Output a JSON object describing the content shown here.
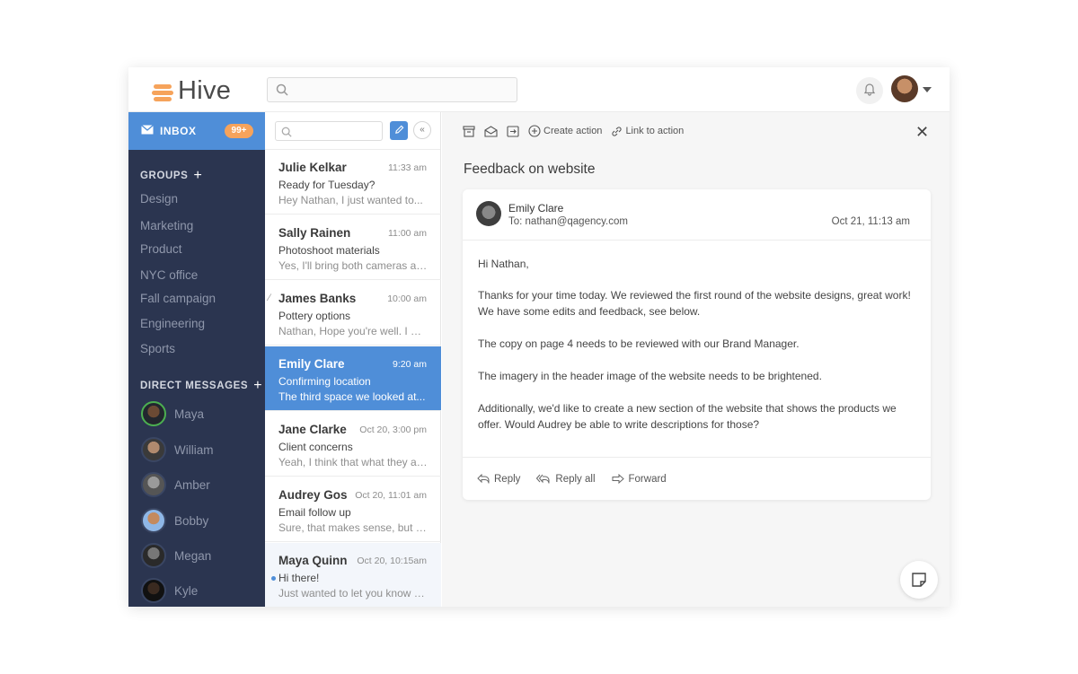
{
  "app": {
    "name": "Hive"
  },
  "header": {
    "search_placeholder": ""
  },
  "sidebar": {
    "inbox_label": "INBOX",
    "inbox_badge": "99+",
    "groups_label": "GROUPS",
    "groups": [
      "Design",
      "Marketing",
      "Product",
      "NYC office",
      "Fall campaign",
      "Engineering",
      "Sports"
    ],
    "dm_label": "DIRECT MESSAGES",
    "direct_messages": [
      "Maya",
      "William",
      "Amber",
      "Bobby",
      "Megan",
      "Kyle"
    ]
  },
  "messages": [
    {
      "sender": "Julie Kelkar",
      "time": "11:33 am",
      "subject": "Ready for Tuesday?",
      "preview": "Hey Nathan, I just wanted to..."
    },
    {
      "sender": "Sally Rainen",
      "time": "11:00 am",
      "subject": "Photoshoot materials",
      "preview": "Yes, I'll bring both cameras an..."
    },
    {
      "sender": "James Banks",
      "time": "10:00 am",
      "subject": "Pottery options",
      "preview": "Nathan, Hope you're well. I wi..."
    },
    {
      "sender": "Emily Clare",
      "time": "9:20 am",
      "subject": "Confirming location",
      "preview": "The third space we looked at..."
    },
    {
      "sender": "Jane Clarke",
      "time": "Oct 20, 3:00 pm",
      "subject": "Client concerns",
      "preview": "Yeah, I think that what they are..."
    },
    {
      "sender": "Audrey Gos",
      "time": "Oct 20, 11:01 am",
      "subject": "Email follow up",
      "preview": "Sure, that makes sense, but w..."
    },
    {
      "sender": "Maya Quinn",
      "time": "Oct 20, 10:15am",
      "subject": "Hi there!",
      "preview": "Just wanted to let you know th..."
    }
  ],
  "toolbar": {
    "create_action": "Create action",
    "link_action": "Link to action"
  },
  "email": {
    "subject": "Feedback on website",
    "from_name": "Emily Clare",
    "to": "To: nathan@qagency.com",
    "date": "Oct 21, 11:13 am",
    "greeting": "Hi Nathan,",
    "p1": "Thanks for your time today. We reviewed the first round of the website designs, great work! We have some edits and feedback, see below.",
    "p2": "The copy on page 4 needs to be reviewed with our Brand Manager.",
    "p3": "The imagery in the header image of the website needs to be brightened.",
    "p4": "Additionally, we'd like to create a new section of the website that shows the products we offer. Would Audrey be able to write descriptions for those?"
  },
  "actions": {
    "reply": "Reply",
    "reply_all": "Reply all",
    "forward": "Forward"
  },
  "colors": {
    "accent": "#4f8ed8",
    "sidebar": "#2b3550",
    "badge": "#f6a35b"
  }
}
